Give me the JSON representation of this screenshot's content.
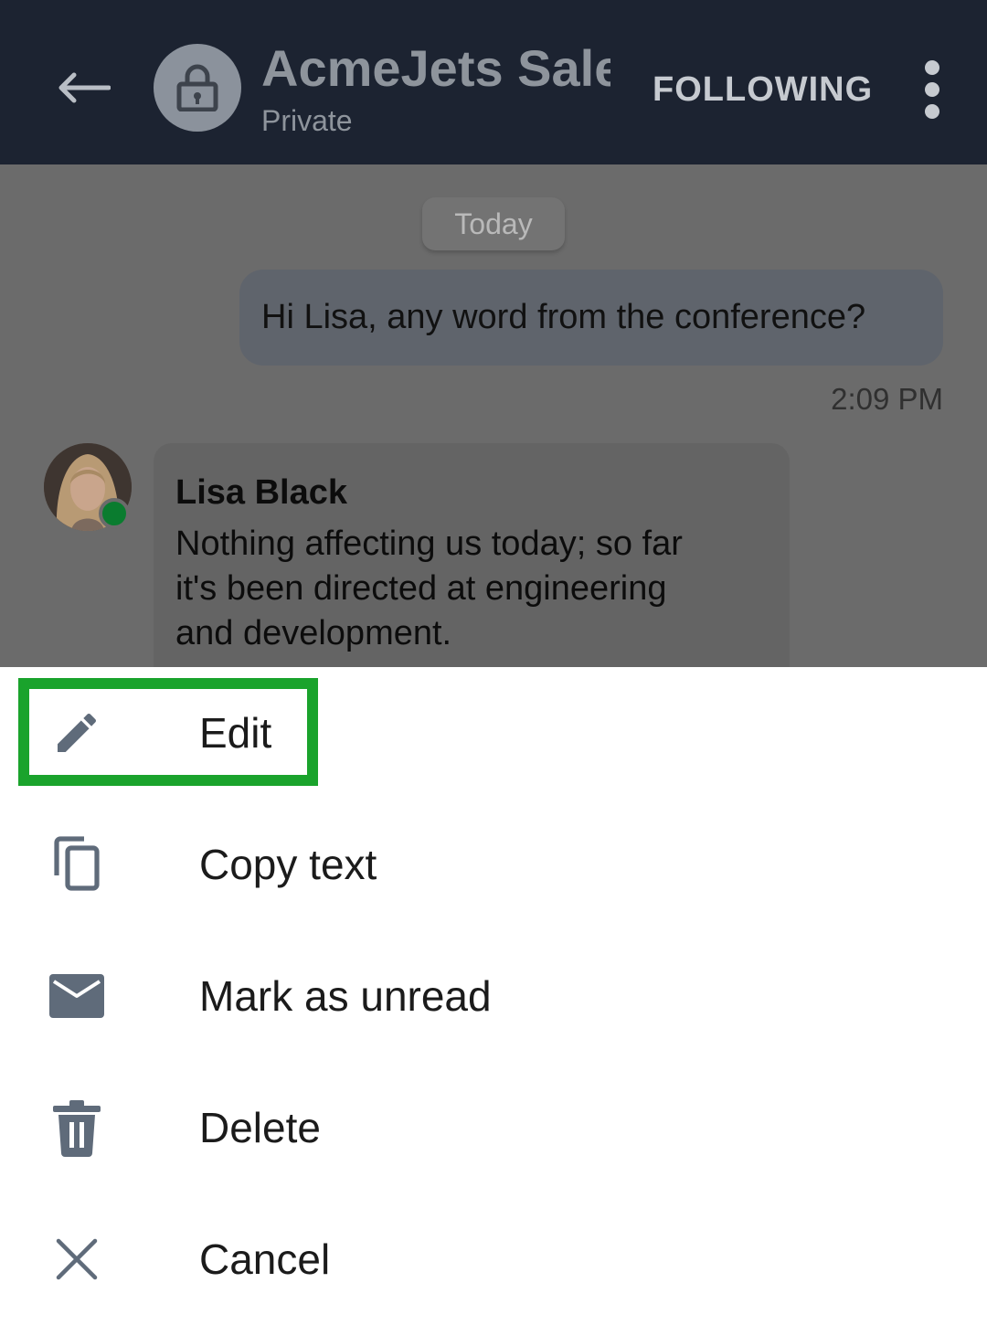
{
  "header": {
    "title": "AcmeJets Sales",
    "subtitle": "Private",
    "follow_label": "FOLLOWING"
  },
  "chat": {
    "date_pill": "Today",
    "outgoing": {
      "text": "Hi Lisa, any word from the conference?",
      "time": "2:09 PM"
    },
    "incoming": {
      "sender": "Lisa Black",
      "lines": [
        "Nothing affecting us today; so far",
        "it's been directed at engineering",
        "and development."
      ],
      "presence": "online"
    }
  },
  "menu": {
    "items": [
      {
        "label": "Edit",
        "icon": "pencil-icon",
        "highlighted": true
      },
      {
        "label": "Copy text",
        "icon": "copy-icon"
      },
      {
        "label": "Mark as unread",
        "icon": "envelope-icon"
      },
      {
        "label": "Delete",
        "icon": "trash-icon"
      },
      {
        "label": "Cancel",
        "icon": "close-icon"
      }
    ]
  },
  "colors": {
    "header_bg": "#1c2331",
    "overlay": "#6b6b6b",
    "icon_gray": "#5f6b7a",
    "highlight": "#1aa32c",
    "presence": "#0a7c2f"
  }
}
